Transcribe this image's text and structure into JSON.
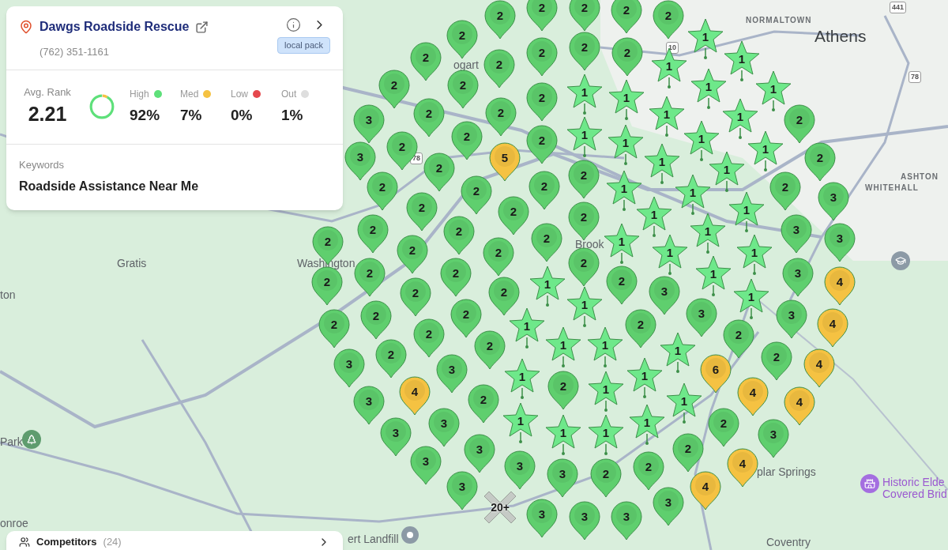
{
  "business": {
    "name": "Dawgs Roadside Rescue",
    "phone": "(762) 351-1161",
    "badge": "local pack"
  },
  "summary": {
    "avg_label": "Avg. Rank",
    "avg_value": "2.21",
    "stats": [
      {
        "label": "High",
        "value": "92%",
        "color": "#5ee07a",
        "level": 0.92
      },
      {
        "label": "Med",
        "value": "7%",
        "color": "#f5c242",
        "level": 0.07
      },
      {
        "label": "Low",
        "value": "0%",
        "color": "#e5484d",
        "level": 0
      },
      {
        "label": "Out",
        "value": "1%",
        "color": "#dedede",
        "level": 0.01
      }
    ]
  },
  "keywords": {
    "label": "Keywords",
    "value": "Roadside Assistance Near Me"
  },
  "competitors": {
    "label": "Competitors",
    "count": "(24)"
  },
  "map_labels": [
    {
      "text": "NORMALTOWN",
      "kind": "district"
    },
    {
      "text": "Athens",
      "kind": "city"
    },
    {
      "text": "ogart",
      "kind": "town"
    },
    {
      "text": "WHITEHALL",
      "kind": "district"
    },
    {
      "text": "ASHTON",
      "kind": "district"
    },
    {
      "text": "Gratis",
      "kind": "town"
    },
    {
      "text": "ton",
      "kind": "town"
    },
    {
      "text": "Park",
      "kind": "town"
    },
    {
      "text": "onroe",
      "kind": "town"
    },
    {
      "text": "Washington",
      "kind": "town"
    },
    {
      "text": "Brook",
      "kind": "town"
    },
    {
      "text": "plar Springs",
      "kind": "town"
    },
    {
      "text": "Historic Elde",
      "kind": "poi"
    },
    {
      "text": "Covered Brid",
      "kind": "poi"
    },
    {
      "text": "ert Landfill",
      "kind": "town"
    },
    {
      "text": "Coventry",
      "kind": "town"
    },
    {
      "text": "441",
      "kind": "shield"
    },
    {
      "text": "78",
      "kind": "shield"
    },
    {
      "text": "78",
      "kind": "shield"
    },
    {
      "text": "10",
      "kind": "shield"
    }
  ],
  "pins": [
    {
      "rank": "2",
      "kind": "pin",
      "color": "#5fcf6e"
    },
    {
      "rank": "2",
      "kind": "pin",
      "color": "#5fcf6e"
    },
    {
      "rank": "2",
      "kind": "pin",
      "color": "#5fcf6e"
    },
    {
      "rank": "2",
      "kind": "pin",
      "color": "#5fcf6e"
    },
    {
      "rank": "2",
      "kind": "pin",
      "color": "#5fcf6e"
    },
    {
      "rank": "2",
      "kind": "pin",
      "color": "#5fcf6e"
    },
    {
      "rank": "1",
      "kind": "star",
      "color": "#6ee88a"
    },
    {
      "rank": "2",
      "kind": "pin",
      "color": "#5fcf6e"
    },
    {
      "rank": "2",
      "kind": "pin",
      "color": "#5fcf6e"
    },
    {
      "rank": "2",
      "kind": "pin",
      "color": "#5fcf6e"
    },
    {
      "rank": "2",
      "kind": "pin",
      "color": "#5fcf6e"
    },
    {
      "rank": "2",
      "kind": "pin",
      "color": "#5fcf6e"
    },
    {
      "rank": "1",
      "kind": "star",
      "color": "#6ee88a"
    },
    {
      "rank": "1",
      "kind": "star",
      "color": "#6ee88a"
    },
    {
      "rank": "2",
      "kind": "pin",
      "color": "#5fcf6e"
    },
    {
      "rank": "2",
      "kind": "pin",
      "color": "#5fcf6e"
    },
    {
      "rank": "2",
      "kind": "pin",
      "color": "#5fcf6e"
    },
    {
      "rank": "1",
      "kind": "star",
      "color": "#6ee88a"
    },
    {
      "rank": "1",
      "kind": "star",
      "color": "#6ee88a"
    },
    {
      "rank": "1",
      "kind": "star",
      "color": "#6ee88a"
    },
    {
      "rank": "1",
      "kind": "star",
      "color": "#6ee88a"
    },
    {
      "rank": "3",
      "kind": "pin",
      "color": "#5fcf6e"
    },
    {
      "rank": "2",
      "kind": "pin",
      "color": "#5fcf6e"
    },
    {
      "rank": "2",
      "kind": "pin",
      "color": "#5fcf6e"
    },
    {
      "rank": "1",
      "kind": "star",
      "color": "#6ee88a"
    },
    {
      "rank": "1",
      "kind": "star",
      "color": "#6ee88a"
    },
    {
      "rank": "2",
      "kind": "pin",
      "color": "#5fcf6e"
    },
    {
      "rank": "2",
      "kind": "pin",
      "color": "#5fcf6e"
    },
    {
      "rank": "2",
      "kind": "pin",
      "color": "#5fcf6e"
    },
    {
      "rank": "2",
      "kind": "pin",
      "color": "#5fcf6e"
    },
    {
      "rank": "1",
      "kind": "star",
      "color": "#6ee88a"
    },
    {
      "rank": "1",
      "kind": "star",
      "color": "#6ee88a"
    },
    {
      "rank": "1",
      "kind": "star",
      "color": "#6ee88a"
    },
    {
      "rank": "1",
      "kind": "star",
      "color": "#6ee88a"
    },
    {
      "rank": "3",
      "kind": "pin",
      "color": "#5fcf6e"
    },
    {
      "rank": "5",
      "kind": "pin",
      "color": "#f5c242"
    },
    {
      "rank": "1",
      "kind": "star",
      "color": "#6ee88a"
    },
    {
      "rank": "2",
      "kind": "pin",
      "color": "#5fcf6e"
    },
    {
      "rank": "2",
      "kind": "pin",
      "color": "#5fcf6e"
    },
    {
      "rank": "2",
      "kind": "pin",
      "color": "#5fcf6e"
    },
    {
      "rank": "1",
      "kind": "star",
      "color": "#6ee88a"
    },
    {
      "rank": "2",
      "kind": "pin",
      "color": "#5fcf6e"
    },
    {
      "rank": "2",
      "kind": "pin",
      "color": "#5fcf6e"
    },
    {
      "rank": "2",
      "kind": "pin",
      "color": "#5fcf6e"
    },
    {
      "rank": "1",
      "kind": "star",
      "color": "#6ee88a"
    },
    {
      "rank": "1",
      "kind": "star",
      "color": "#6ee88a"
    },
    {
      "rank": "2",
      "kind": "pin",
      "color": "#5fcf6e"
    },
    {
      "rank": "3",
      "kind": "pin",
      "color": "#5fcf6e"
    },
    {
      "rank": "2",
      "kind": "pin",
      "color": "#5fcf6e"
    },
    {
      "rank": "2",
      "kind": "pin",
      "color": "#5fcf6e"
    },
    {
      "rank": "2",
      "kind": "pin",
      "color": "#5fcf6e"
    },
    {
      "rank": "1",
      "kind": "star",
      "color": "#6ee88a"
    },
    {
      "rank": "1",
      "kind": "star",
      "color": "#6ee88a"
    },
    {
      "rank": "2",
      "kind": "pin",
      "color": "#5fcf6e"
    },
    {
      "rank": "2",
      "kind": "pin",
      "color": "#5fcf6e"
    },
    {
      "rank": "1",
      "kind": "star",
      "color": "#6ee88a"
    },
    {
      "rank": "3",
      "kind": "pin",
      "color": "#5fcf6e"
    },
    {
      "rank": "2",
      "kind": "pin",
      "color": "#5fcf6e"
    },
    {
      "rank": "2",
      "kind": "pin",
      "color": "#5fcf6e"
    },
    {
      "rank": "1",
      "kind": "star",
      "color": "#6ee88a"
    },
    {
      "rank": "3",
      "kind": "pin",
      "color": "#5fcf6e"
    },
    {
      "rank": "2",
      "kind": "pin",
      "color": "#5fcf6e"
    },
    {
      "rank": "2",
      "kind": "pin",
      "color": "#5fcf6e"
    },
    {
      "rank": "1",
      "kind": "star",
      "color": "#6ee88a"
    },
    {
      "rank": "1",
      "kind": "star",
      "color": "#6ee88a"
    },
    {
      "rank": "2",
      "kind": "pin",
      "color": "#5fcf6e"
    },
    {
      "rank": "2",
      "kind": "pin",
      "color": "#5fcf6e"
    },
    {
      "rank": "2",
      "kind": "pin",
      "color": "#5fcf6e"
    },
    {
      "rank": "1",
      "kind": "star",
      "color": "#6ee88a"
    },
    {
      "rank": "3",
      "kind": "pin",
      "color": "#5fcf6e"
    },
    {
      "rank": "2",
      "kind": "pin",
      "color": "#5fcf6e"
    },
    {
      "rank": "1",
      "kind": "star",
      "color": "#6ee88a"
    },
    {
      "rank": "2",
      "kind": "pin",
      "color": "#5fcf6e"
    },
    {
      "rank": "4",
      "kind": "pin",
      "color": "#f5c242"
    },
    {
      "rank": "2",
      "kind": "pin",
      "color": "#5fcf6e"
    },
    {
      "rank": "2",
      "kind": "pin",
      "color": "#5fcf6e"
    },
    {
      "rank": "3",
      "kind": "pin",
      "color": "#5fcf6e"
    },
    {
      "rank": "1",
      "kind": "star",
      "color": "#6ee88a"
    },
    {
      "rank": "1",
      "kind": "star",
      "color": "#6ee88a"
    },
    {
      "rank": "2",
      "kind": "pin",
      "color": "#5fcf6e"
    },
    {
      "rank": "2",
      "kind": "pin",
      "color": "#5fcf6e"
    },
    {
      "rank": "3",
      "kind": "pin",
      "color": "#5fcf6e"
    },
    {
      "rank": "3",
      "kind": "pin",
      "color": "#5fcf6e"
    },
    {
      "rank": "2",
      "kind": "pin",
      "color": "#5fcf6e"
    },
    {
      "rank": "1",
      "kind": "star",
      "color": "#6ee88a"
    },
    {
      "rank": "2",
      "kind": "pin",
      "color": "#5fcf6e"
    },
    {
      "rank": "4",
      "kind": "pin",
      "color": "#f5c242"
    },
    {
      "rank": "2",
      "kind": "pin",
      "color": "#5fcf6e"
    },
    {
      "rank": "2",
      "kind": "pin",
      "color": "#5fcf6e"
    },
    {
      "rank": "2",
      "kind": "pin",
      "color": "#5fcf6e"
    },
    {
      "rank": "2",
      "kind": "pin",
      "color": "#5fcf6e"
    },
    {
      "rank": "1",
      "kind": "star",
      "color": "#6ee88a"
    },
    {
      "rank": "1",
      "kind": "star",
      "color": "#6ee88a"
    },
    {
      "rank": "1",
      "kind": "star",
      "color": "#6ee88a"
    },
    {
      "rank": "2",
      "kind": "pin",
      "color": "#5fcf6e"
    },
    {
      "rank": "3",
      "kind": "pin",
      "color": "#5fcf6e"
    },
    {
      "rank": "3",
      "kind": "pin",
      "color": "#5fcf6e"
    },
    {
      "rank": "6",
      "kind": "pin",
      "color": "#f5c242"
    },
    {
      "rank": "4",
      "kind": "pin",
      "color": "#f5c242"
    },
    {
      "rank": "1",
      "kind": "star",
      "color": "#6ee88a"
    },
    {
      "rank": "1",
      "kind": "star",
      "color": "#6ee88a"
    },
    {
      "rank": "4",
      "kind": "pin",
      "color": "#f5c242"
    },
    {
      "rank": "2",
      "kind": "pin",
      "color": "#5fcf6e"
    },
    {
      "rank": "1",
      "kind": "star",
      "color": "#6ee88a"
    },
    {
      "rank": "4",
      "kind": "pin",
      "color": "#f5c242"
    },
    {
      "rank": "3",
      "kind": "pin",
      "color": "#5fcf6e"
    },
    {
      "rank": "2",
      "kind": "pin",
      "color": "#5fcf6e"
    },
    {
      "rank": "1",
      "kind": "star",
      "color": "#6ee88a"
    },
    {
      "rank": "4",
      "kind": "pin",
      "color": "#f5c242"
    },
    {
      "rank": "3",
      "kind": "pin",
      "color": "#5fcf6e"
    },
    {
      "rank": "1",
      "kind": "star",
      "color": "#6ee88a"
    },
    {
      "rank": "1",
      "kind": "star",
      "color": "#6ee88a"
    },
    {
      "rank": "2",
      "kind": "pin",
      "color": "#5fcf6e"
    },
    {
      "rank": "3",
      "kind": "pin",
      "color": "#5fcf6e"
    },
    {
      "rank": "1",
      "kind": "star",
      "color": "#6ee88a"
    },
    {
      "rank": "1",
      "kind": "star",
      "color": "#6ee88a"
    },
    {
      "rank": "3",
      "kind": "pin",
      "color": "#5fcf6e"
    },
    {
      "rank": "3",
      "kind": "pin",
      "color": "#5fcf6e"
    },
    {
      "rank": "2",
      "kind": "pin",
      "color": "#5fcf6e"
    },
    {
      "rank": "3",
      "kind": "pin",
      "color": "#5fcf6e"
    },
    {
      "rank": "3",
      "kind": "pin",
      "color": "#5fcf6e"
    },
    {
      "rank": "2",
      "kind": "pin",
      "color": "#5fcf6e"
    },
    {
      "rank": "4",
      "kind": "pin",
      "color": "#f5c242"
    },
    {
      "rank": "3",
      "kind": "pin",
      "color": "#5fcf6e"
    },
    {
      "rank": "2",
      "kind": "pin",
      "color": "#5fcf6e"
    },
    {
      "rank": "3",
      "kind": "pin",
      "color": "#5fcf6e"
    },
    {
      "rank": "4",
      "kind": "pin",
      "color": "#f5c242"
    },
    {
      "rank": "20+",
      "kind": "out",
      "color": "#c5cac5"
    },
    {
      "rank": "3",
      "kind": "pin",
      "color": "#5fcf6e"
    },
    {
      "rank": "3",
      "kind": "pin",
      "color": "#5fcf6e"
    },
    {
      "rank": "3",
      "kind": "pin",
      "color": "#5fcf6e"
    },
    {
      "rank": "3",
      "kind": "pin",
      "color": "#5fcf6e"
    }
  ]
}
